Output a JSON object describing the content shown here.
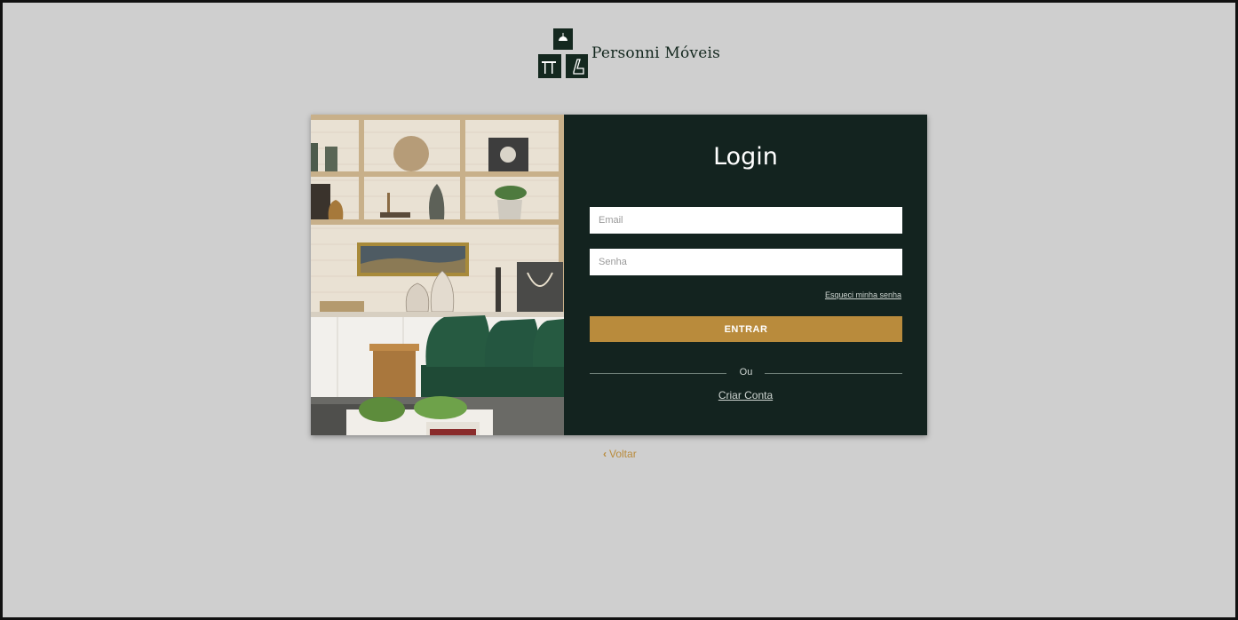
{
  "brand": {
    "name": "Personni Móveis"
  },
  "login": {
    "title": "Login",
    "email_placeholder": "Email",
    "password_placeholder": "Senha",
    "forgot_label": "Esqueci minha senha",
    "submit_label": "ENTRAR",
    "divider_label": "Ou",
    "create_account_label": "Criar Conta"
  },
  "nav": {
    "back_label": "Voltar",
    "back_icon": "chevron-left-icon"
  },
  "colors": {
    "background": "#cfcfcf",
    "panel": "#13231f",
    "accent": "#b98b3c",
    "sofa": "#1f4a36"
  }
}
